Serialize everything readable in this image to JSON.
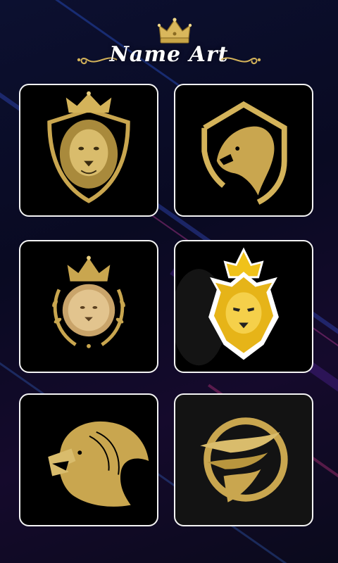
{
  "app": {
    "title": "Name Art"
  },
  "header": {
    "crown_icon": "crown-icon",
    "left_flourish_icon": "flourish-left-icon",
    "right_flourish_icon": "flourish-right-icon"
  },
  "colors": {
    "gold": "#d4b35a",
    "gold_dark": "#8a6b22",
    "card_border": "#f4f4f4",
    "background": "#0a0b24"
  },
  "logos": [
    {
      "icon": "lion-shield-crown-logo"
    },
    {
      "icon": "lion-profile-shield-logo"
    },
    {
      "icon": "lion-laurel-crown-logo"
    },
    {
      "icon": "lion-king-mascot-logo"
    },
    {
      "icon": "roaring-lion-logo"
    },
    {
      "icon": "swoosh-circle-logo"
    }
  ]
}
